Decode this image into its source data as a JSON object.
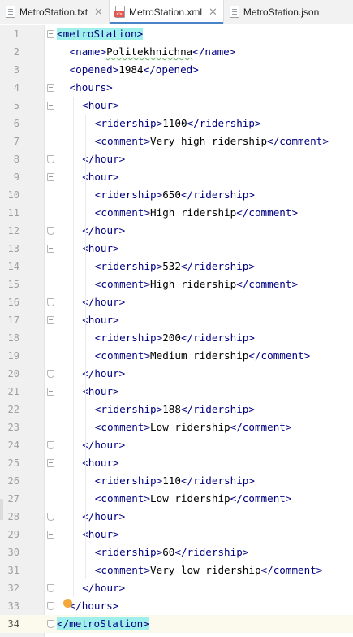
{
  "tabs": [
    {
      "label": "MetroStation.txt",
      "icon": "text-file-icon",
      "active": false,
      "close": "✕"
    },
    {
      "label": "MetroStation.xml",
      "icon": "xml-file-icon",
      "active": true,
      "close": "✕"
    },
    {
      "label": "MetroStation.json",
      "icon": "json-file-icon",
      "active": false,
      "close": ""
    }
  ],
  "editor": {
    "current_line": 34,
    "lines": [
      {
        "n": "1",
        "indent": 0,
        "parts": [
          [
            "tg",
            "<"
          ],
          [
            "tg",
            "metroStation"
          ],
          [
            "tg",
            ">"
          ]
        ]
      },
      {
        "n": "2",
        "indent": 1,
        "parts": [
          [
            "tg",
            "<name>"
          ],
          [
            "tx",
            "Politekhnichna"
          ],
          [
            "tg",
            "</name>"
          ]
        ]
      },
      {
        "n": "3",
        "indent": 1,
        "parts": [
          [
            "tg",
            "<opened>"
          ],
          [
            "tx",
            "1984"
          ],
          [
            "tg",
            "</opened>"
          ]
        ]
      },
      {
        "n": "4",
        "indent": 1,
        "parts": [
          [
            "tg",
            "<hours>"
          ]
        ]
      },
      {
        "n": "5",
        "indent": 2,
        "parts": [
          [
            "tg",
            "<hour>"
          ]
        ]
      },
      {
        "n": "6",
        "indent": 3,
        "parts": [
          [
            "tg",
            "<ridership>"
          ],
          [
            "tx",
            "1100"
          ],
          [
            "tg",
            "</ridership>"
          ]
        ]
      },
      {
        "n": "7",
        "indent": 3,
        "parts": [
          [
            "tg",
            "<comment>"
          ],
          [
            "tx",
            "Very high ridership"
          ],
          [
            "tg",
            "</comment>"
          ]
        ]
      },
      {
        "n": "8",
        "indent": 2,
        "parts": [
          [
            "tg",
            "</hour>"
          ]
        ]
      },
      {
        "n": "9",
        "indent": 2,
        "parts": [
          [
            "tg",
            "<hour>"
          ]
        ]
      },
      {
        "n": "10",
        "indent": 3,
        "parts": [
          [
            "tg",
            "<ridership>"
          ],
          [
            "tx",
            "650"
          ],
          [
            "tg",
            "</ridership>"
          ]
        ]
      },
      {
        "n": "11",
        "indent": 3,
        "parts": [
          [
            "tg",
            "<comment>"
          ],
          [
            "tx",
            "High ridership"
          ],
          [
            "tg",
            "</comment>"
          ]
        ]
      },
      {
        "n": "12",
        "indent": 2,
        "parts": [
          [
            "tg",
            "</hour>"
          ]
        ]
      },
      {
        "n": "13",
        "indent": 2,
        "parts": [
          [
            "tg",
            "<hour>"
          ]
        ]
      },
      {
        "n": "14",
        "indent": 3,
        "parts": [
          [
            "tg",
            "<ridership>"
          ],
          [
            "tx",
            "532"
          ],
          [
            "tg",
            "</ridership>"
          ]
        ]
      },
      {
        "n": "15",
        "indent": 3,
        "parts": [
          [
            "tg",
            "<comment>"
          ],
          [
            "tx",
            "High ridership"
          ],
          [
            "tg",
            "</comment>"
          ]
        ]
      },
      {
        "n": "16",
        "indent": 2,
        "parts": [
          [
            "tg",
            "</hour>"
          ]
        ]
      },
      {
        "n": "17",
        "indent": 2,
        "parts": [
          [
            "tg",
            "<hour>"
          ]
        ]
      },
      {
        "n": "18",
        "indent": 3,
        "parts": [
          [
            "tg",
            "<ridership>"
          ],
          [
            "tx",
            "200"
          ],
          [
            "tg",
            "</ridership>"
          ]
        ]
      },
      {
        "n": "19",
        "indent": 3,
        "parts": [
          [
            "tg",
            "<comment>"
          ],
          [
            "tx",
            "Medium ridership"
          ],
          [
            "tg",
            "</comment>"
          ]
        ]
      },
      {
        "n": "20",
        "indent": 2,
        "parts": [
          [
            "tg",
            "</hour>"
          ]
        ]
      },
      {
        "n": "21",
        "indent": 2,
        "parts": [
          [
            "tg",
            "<hour>"
          ]
        ]
      },
      {
        "n": "22",
        "indent": 3,
        "parts": [
          [
            "tg",
            "<ridership>"
          ],
          [
            "tx",
            "188"
          ],
          [
            "tg",
            "</ridership>"
          ]
        ]
      },
      {
        "n": "23",
        "indent": 3,
        "parts": [
          [
            "tg",
            "<comment>"
          ],
          [
            "tx",
            "Low ridership"
          ],
          [
            "tg",
            "</comment>"
          ]
        ]
      },
      {
        "n": "24",
        "indent": 2,
        "parts": [
          [
            "tg",
            "</hour>"
          ]
        ]
      },
      {
        "n": "25",
        "indent": 2,
        "parts": [
          [
            "tg",
            "<hour>"
          ]
        ]
      },
      {
        "n": "26",
        "indent": 3,
        "parts": [
          [
            "tg",
            "<ridership>"
          ],
          [
            "tx",
            "110"
          ],
          [
            "tg",
            "</ridership>"
          ]
        ]
      },
      {
        "n": "27",
        "indent": 3,
        "parts": [
          [
            "tg",
            "<comment>"
          ],
          [
            "tx",
            "Low ridership"
          ],
          [
            "tg",
            "</comment>"
          ]
        ]
      },
      {
        "n": "28",
        "indent": 2,
        "parts": [
          [
            "tg",
            "</hour>"
          ]
        ]
      },
      {
        "n": "29",
        "indent": 2,
        "parts": [
          [
            "tg",
            "<hour>"
          ]
        ]
      },
      {
        "n": "30",
        "indent": 3,
        "parts": [
          [
            "tg",
            "<ridership>"
          ],
          [
            "tx",
            "60"
          ],
          [
            "tg",
            "</ridership>"
          ]
        ]
      },
      {
        "n": "31",
        "indent": 3,
        "parts": [
          [
            "tg",
            "<comment>"
          ],
          [
            "tx",
            "Very low ridership"
          ],
          [
            "tg",
            "</comment>"
          ]
        ]
      },
      {
        "n": "32",
        "indent": 2,
        "parts": [
          [
            "tg",
            "</hour>"
          ]
        ]
      },
      {
        "n": "33",
        "indent": 1,
        "parts": [
          [
            "tg",
            "</hours>"
          ]
        ]
      },
      {
        "n": "34",
        "indent": 0,
        "parts": [
          [
            "tg",
            "</"
          ],
          [
            "tg",
            "metroStation"
          ],
          [
            "tg",
            ">"
          ]
        ]
      }
    ]
  },
  "colors": {
    "tag": "#000080",
    "text": "#000000",
    "tag_highlight": "#9ff0ea",
    "current_line": "#fcfaed",
    "active_tab_underline": "#4b83c9"
  }
}
